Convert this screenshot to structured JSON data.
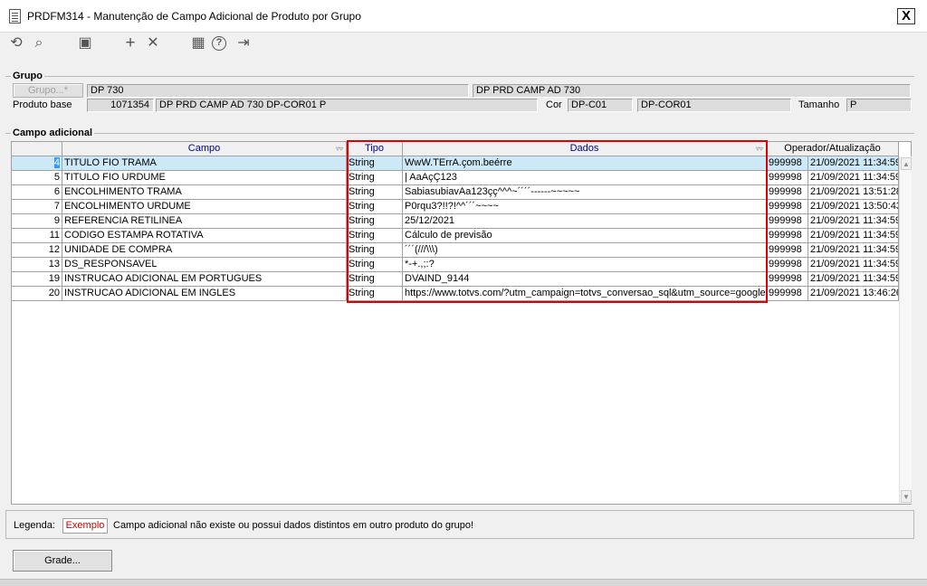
{
  "window": {
    "title": "PRDFM314 - Manutenção de Campo Adicional de Produto por Grupo",
    "close_label": "X"
  },
  "toolbar": {
    "icons": [
      "refresh-icon",
      "search-icon",
      "save-icon",
      "add-icon",
      "delete-icon",
      "calendar-icon",
      "help-icon",
      "exit-icon"
    ],
    "glyphs": {
      "refresh": "⟲",
      "search": "⌕",
      "save": "▣",
      "add": "+",
      "delete": "✕",
      "calendar": "▦",
      "help": "?",
      "exit": "⇥"
    }
  },
  "grupo": {
    "section_title": "Grupo",
    "button_label": "Grupo...*",
    "code": "DP 730",
    "description": "DP PRD CAMP AD 730",
    "produto_base_label": "Produto base",
    "produto_code": "1071354",
    "produto_desc": "DP PRD CAMP AD 730 DP-COR01 P",
    "cor_label": "Cor",
    "cor_code": "DP-C01",
    "cor_desc": "DP-COR01",
    "tamanho_label": "Tamanho",
    "tamanho_value": "P"
  },
  "campo": {
    "section_title": "Campo adicional",
    "columns": {
      "campo": "Campo",
      "tipo": "Tipo",
      "dados": "Dados",
      "operador": "Operador/Atualização"
    },
    "rows": [
      {
        "num": "4",
        "campo": "TITULO FIO TRAMA",
        "tipo": "String",
        "dados": "WwW.TErrA.çom.beérre",
        "operador": "999998",
        "data": "21/09/2021 11:34:59"
      },
      {
        "num": "5",
        "campo": "TITULO FIO URDUME",
        "tipo": "String",
        "dados": "| AaAçÇ123",
        "operador": "999998",
        "data": "21/09/2021 11:34:59"
      },
      {
        "num": "6",
        "campo": "ENCOLHIMENTO TRAMA",
        "tipo": "String",
        "dados": " SabiasubiavAa123çç^^^~´´´´------~~~~~",
        "operador": "999998",
        "data": "21/09/2021 13:51:28"
      },
      {
        "num": "7",
        "campo": "ENCOLHIMENTO URDUME",
        "tipo": "String",
        "dados": "P0rqu3?!!?!^^´´´~~~~",
        "operador": "999998",
        "data": "21/09/2021 13:50:43"
      },
      {
        "num": "9",
        "campo": "REFERENCIA RETILINEA",
        "tipo": "String",
        "dados": "25/12/2021",
        "operador": "999998",
        "data": "21/09/2021 11:34:59"
      },
      {
        "num": "11",
        "campo": "CODIGO ESTAMPA ROTATIVA",
        "tipo": "String",
        "dados": "Cálculo de previsão",
        "operador": "999998",
        "data": "21/09/2021 11:34:59"
      },
      {
        "num": "12",
        "campo": "UNIDADE DE COMPRA",
        "tipo": "String",
        "dados": "´´´(///\\\\\\)",
        "operador": "999998",
        "data": "21/09/2021 11:34:59"
      },
      {
        "num": "13",
        "campo": "DS_RESPONSAVEL",
        "tipo": "String",
        "dados": "*-+.,;:?",
        "operador": "999998",
        "data": "21/09/2021 11:34:59"
      },
      {
        "num": "19",
        "campo": "INSTRUCAO ADICIONAL EM PORTUGUES",
        "tipo": "String",
        "dados": "DVAIND_9144",
        "operador": "999998",
        "data": "21/09/2021 11:34:59"
      },
      {
        "num": "20",
        "campo": "INSTRUCAO ADICIONAL EM INGLES",
        "tipo": "String",
        "dados": "https://www.totvs.com/?utm_campaign=totvs_conversao_sql&utm_source=google",
        "operador": "999998",
        "data": "21/09/2021 13:46:26"
      }
    ]
  },
  "legend": {
    "label": "Legenda:",
    "sample": "Exemplo",
    "text": "Campo adicional não existe ou possui dados distintos em outro produto do grupo!"
  },
  "footer": {
    "grade_button": "Grade..."
  },
  "colors": {
    "highlight": "#e00000",
    "selected_row": "#cde8f6",
    "header_text": "#00008b",
    "legend_sample": "#d00000"
  }
}
